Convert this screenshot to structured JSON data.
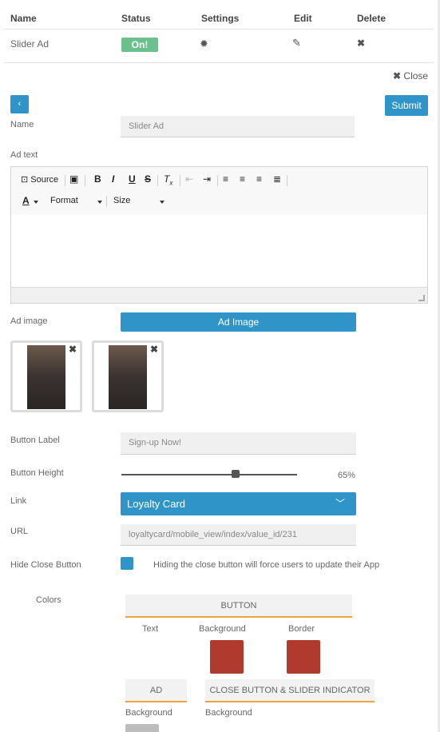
{
  "table": {
    "headers": [
      "Name",
      "Status",
      "Settings",
      "Edit",
      "Delete"
    ],
    "row": {
      "name": "Slider Ad",
      "status": "On!"
    }
  },
  "form": {
    "close_label": "Close",
    "submit_label": "Submit",
    "back_icon": "chevron-left-icon",
    "name_label": "Name",
    "name_value": "Slider Ad",
    "ad_text_label": "Ad text",
    "toolbar": {
      "source_label": "Source",
      "bold": "B",
      "italic": "I",
      "underline": "U",
      "strike": "S",
      "format_label": "Format",
      "size_label": "Size"
    },
    "ad_image_label": "Ad image",
    "ad_image_button": "Ad Image",
    "button_label_label": "Button Label",
    "button_label_value": "Sign-up Now!",
    "button_height_label": "Button Height",
    "button_height_value": 0.65,
    "button_height_text": "65%",
    "link_label": "Link",
    "link_value": "Loyalty Card",
    "url_label": "URL",
    "url_value": "loyaltycard/mobile_view/index/value_id/231",
    "hide_close_label": "Hide Close Button",
    "hide_close_hint": "Hiding the close button will force users to update their App",
    "colors_label": "Colors",
    "button_tab": "BUTTON",
    "text_col": "Text",
    "background_col": "Background",
    "border_col": "Border",
    "ad_tab": "AD",
    "close_slider_tab": "CLOSE BUTTON & SLIDER INDICATOR",
    "ad_background": "Background",
    "close_background": "Background"
  },
  "colors": {
    "accent": "#2f95c9",
    "on_badge": "#6cc08d",
    "swatch_red": "#b03a2e",
    "tab_underline": "#f0a33a"
  }
}
